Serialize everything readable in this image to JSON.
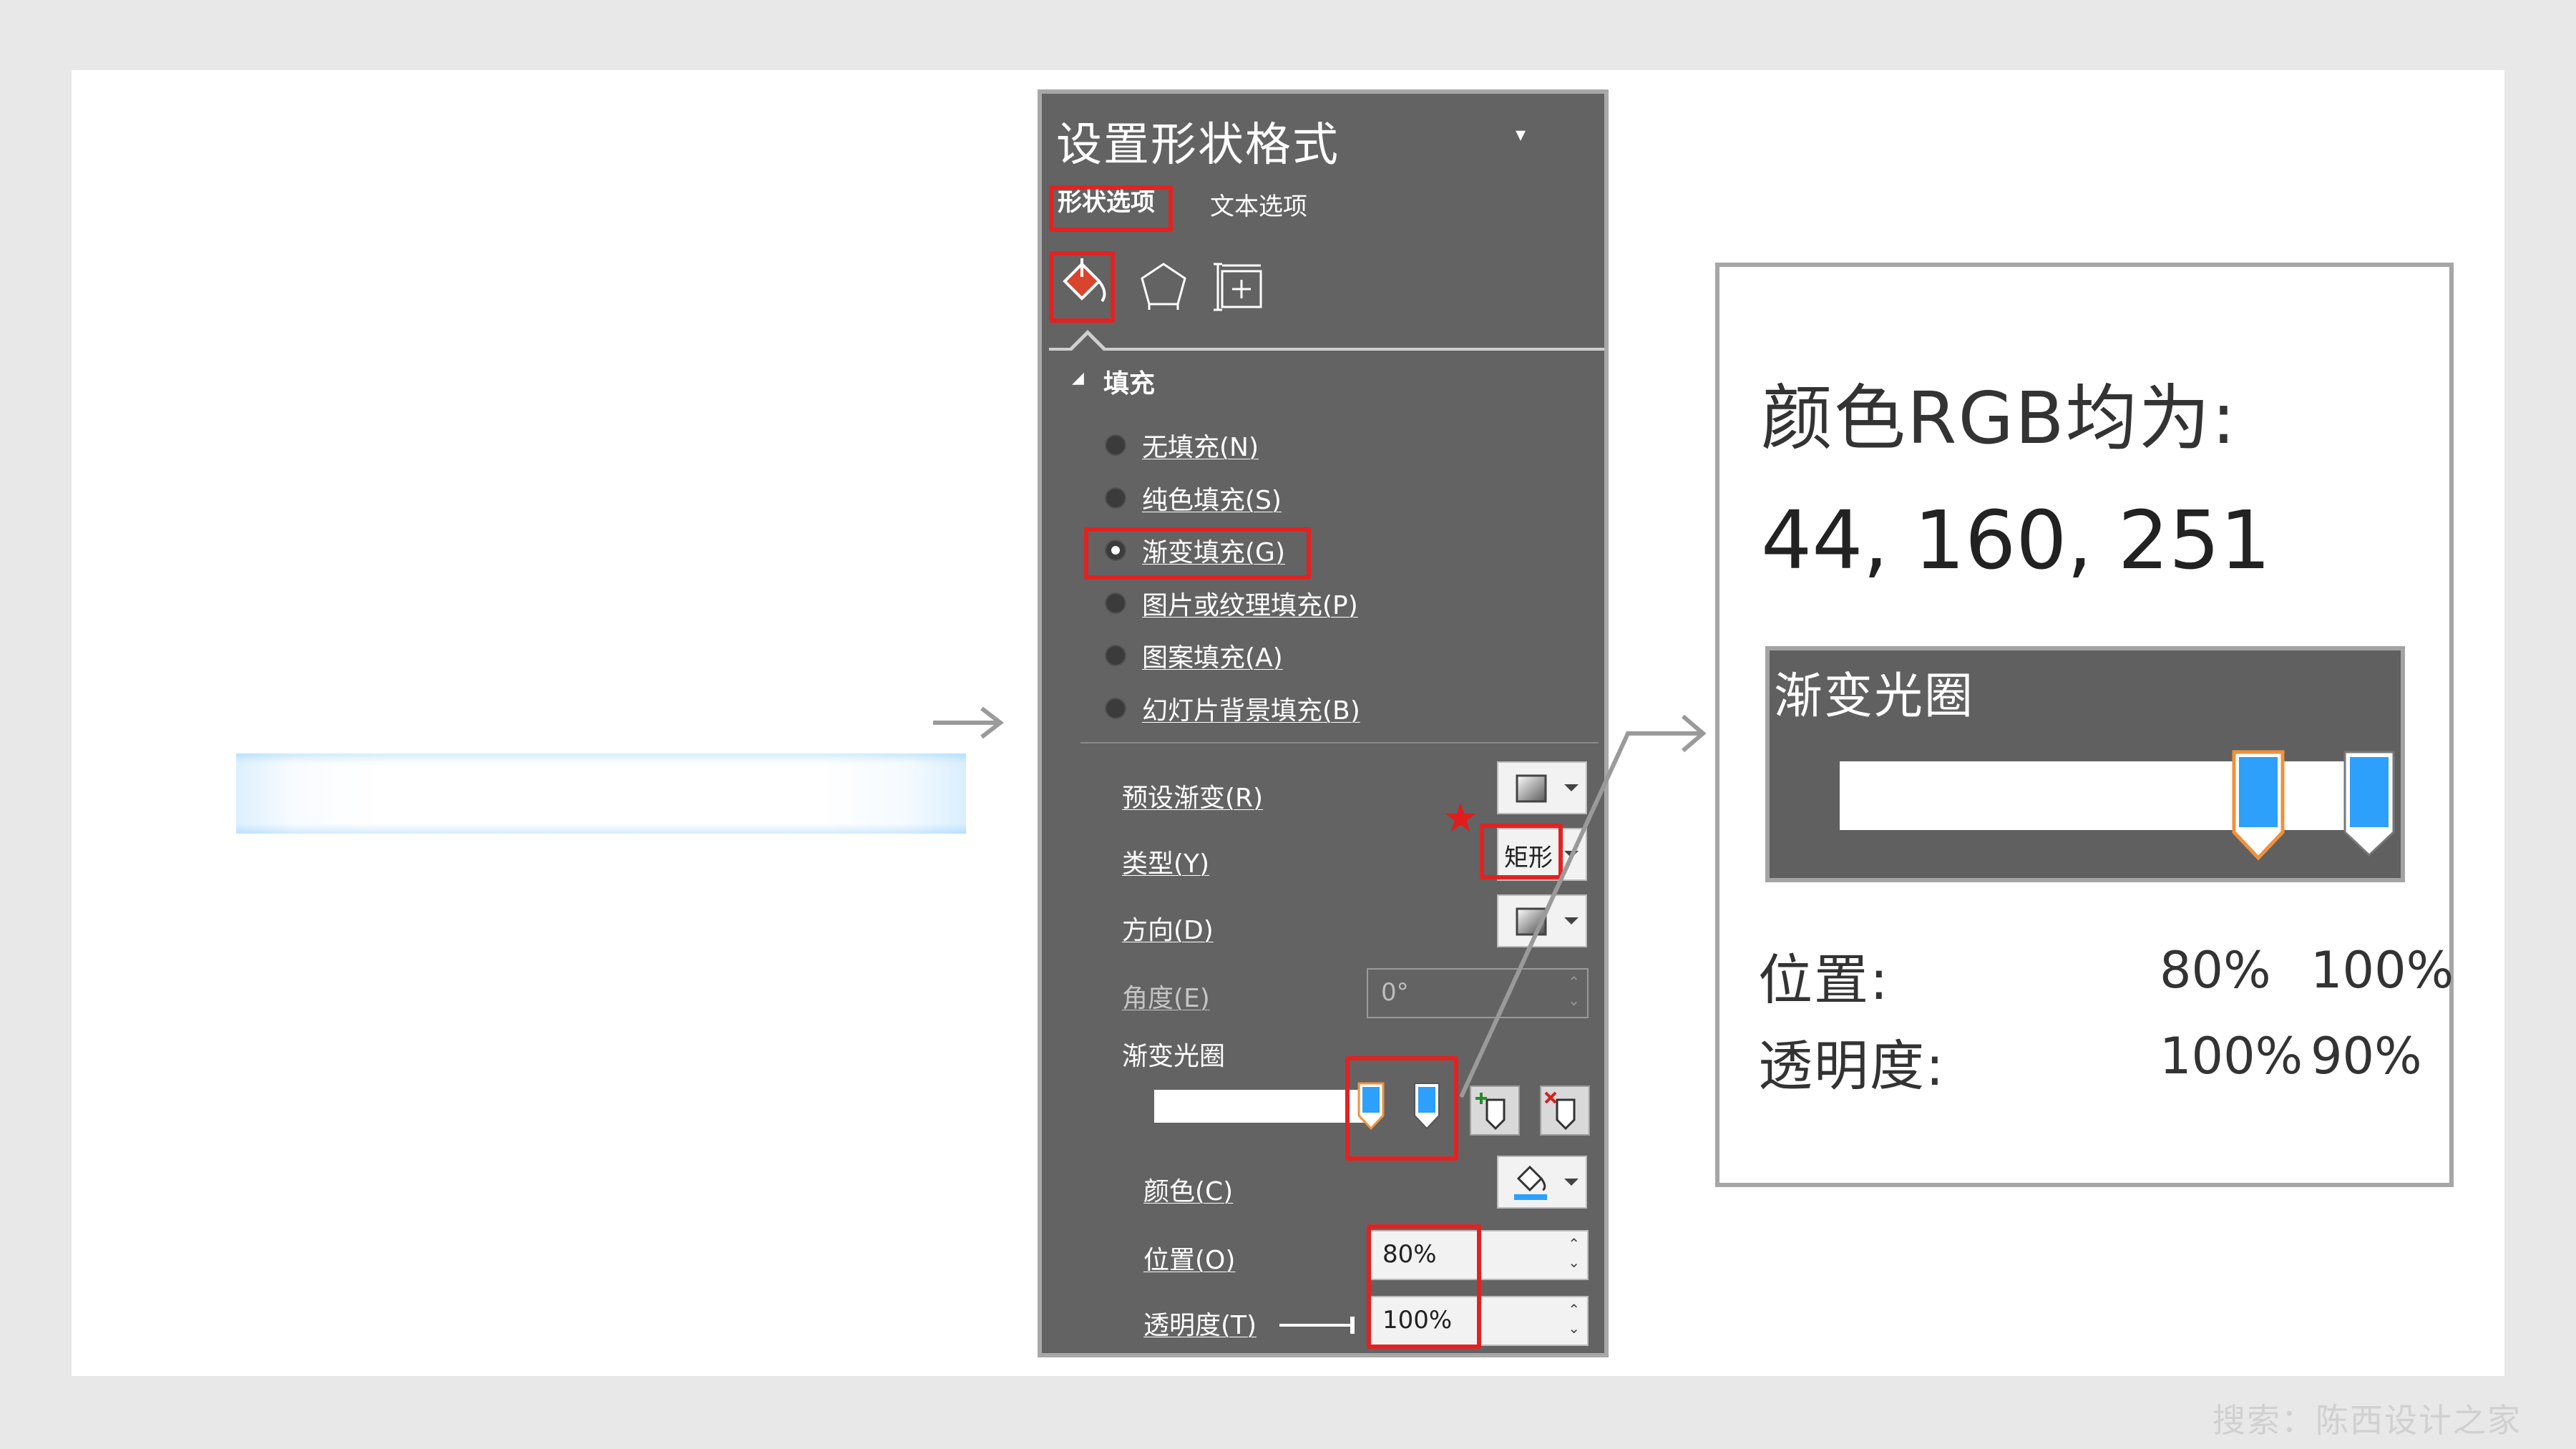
{
  "panel": {
    "title": "设置形状格式",
    "title_dropdown": "▾",
    "tabs": {
      "shape_options": "形状选项",
      "text_options": "文本选项"
    },
    "category_icons": [
      "fill-line-icon",
      "effects-pentagon-icon",
      "size-properties-icon"
    ],
    "fill_section": {
      "collapse_glyph": "◢",
      "title": "填充",
      "options": [
        {
          "label": "无填充(N)",
          "selected": false
        },
        {
          "label": "纯色填充(S)",
          "selected": false
        },
        {
          "label": "渐变填充(G)",
          "selected": true
        },
        {
          "label": "图片或纹理填充(P)",
          "selected": false
        },
        {
          "label": "图案填充(A)",
          "selected": false
        },
        {
          "label": "幻灯片背景填充(B)",
          "selected": false
        }
      ]
    },
    "gradient": {
      "preset_label": "预设渐变(R)",
      "type_label": "类型(Y)",
      "type_value": "矩形",
      "type_marker": "★",
      "direction_label": "方向(D)",
      "angle_label": "角度(E)",
      "angle_value": "0°",
      "stops_label": "渐变光圈",
      "color_label": "颜色(C)",
      "position_label": "位置(O)",
      "position_value": "80%",
      "transparency_label": "透明度(T)",
      "transparency_value": "100%",
      "stop_color": "#2ca0fb"
    }
  },
  "callout": {
    "rgb_title": "颜色RGB均为:",
    "rgb_values": "44, 160, 251",
    "zoom_title": "渐变光圈",
    "position_label": "位置:",
    "transparency_label": "透明度:",
    "stop1": {
      "position": "80%",
      "transparency": "100%"
    },
    "stop2": {
      "position": "100%",
      "transparency": "90%"
    }
  },
  "watermark": "搜索：陈西设计之家"
}
